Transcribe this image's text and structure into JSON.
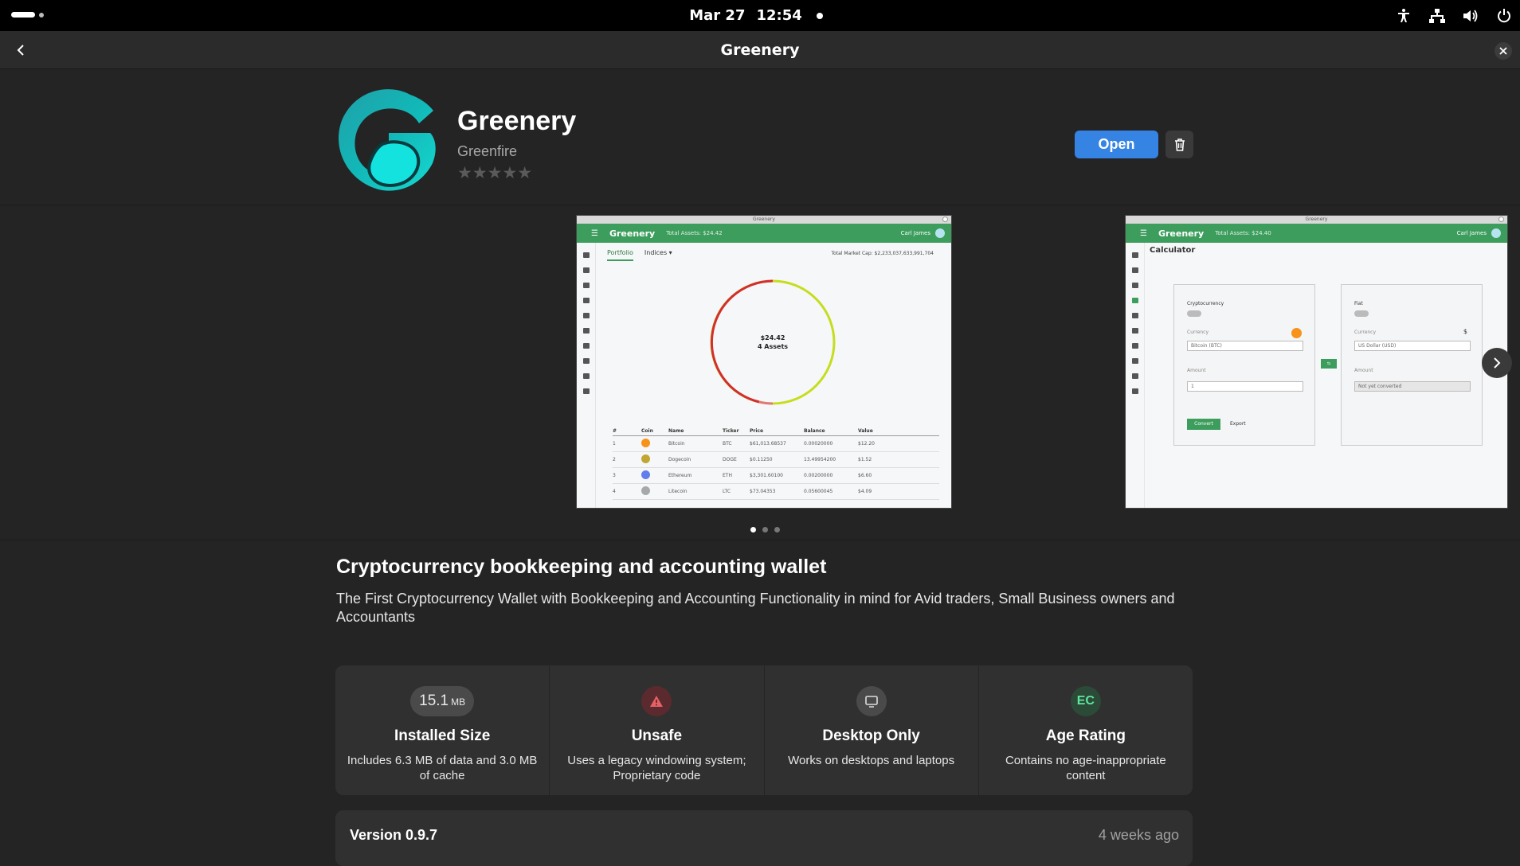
{
  "topbar": {
    "date": "Mar 27",
    "time": "12:54"
  },
  "header": {
    "title": "Greenery"
  },
  "app": {
    "name": "Greenery",
    "developer": "Greenfire",
    "stars": "★★★★★",
    "open_label": "Open",
    "accent_color": "#3584e4"
  },
  "screenshots": {
    "shot1": {
      "window_title": "Greenery",
      "app_name": "Greenery",
      "total_assets": "Total Assets: $24.42",
      "user": "Carl James",
      "tab_portfolio": "Portfolio",
      "tab_indices": "Indices ▾",
      "market_cap": "Total Market Cap: $2,233,037,633,991,704",
      "donut_value": "$24.42",
      "donut_assets": "4 Assets",
      "table": {
        "headers": [
          "#",
          "Coin",
          "Name",
          "Ticker",
          "Price",
          "Balance",
          "Value"
        ],
        "rows": [
          {
            "n": "1",
            "name": "Bitcoin",
            "ticker": "BTC",
            "price": "$61,013.68537",
            "balance": "0.00020000",
            "value": "$12.20",
            "color": "#f7931a"
          },
          {
            "n": "2",
            "name": "Dogecoin",
            "ticker": "DOGE",
            "price": "$0.11250",
            "balance": "13.49954200",
            "value": "$1.52",
            "color": "#c2a633"
          },
          {
            "n": "3",
            "name": "Ethereum",
            "ticker": "ETH",
            "price": "$3,301.60100",
            "balance": "0.00200000",
            "value": "$6.60",
            "color": "#627eea"
          },
          {
            "n": "4",
            "name": "Litecoin",
            "ticker": "LTC",
            "price": "$73.04353",
            "balance": "0.05600045",
            "value": "$4.09",
            "color": "#a6a9aa"
          }
        ]
      }
    },
    "shot2": {
      "window_title": "Greenery",
      "app_name": "Greenery",
      "total_assets": "Total Assets: $24.40",
      "user": "Carl James",
      "page_title": "Calculator",
      "left_card": {
        "title": "Cryptocurrency",
        "currency_label": "Currency",
        "currency_value": "Bitcoin (BTC)",
        "amount_label": "Amount",
        "amount_value": "1",
        "convert_label": "Convert",
        "export_label": "Export"
      },
      "right_card": {
        "title": "Fiat",
        "currency_label": "Currency",
        "currency_symbol": "$",
        "currency_value": "US Dollar (USD)",
        "amount_label": "Amount",
        "amount_value": "Not yet converted"
      }
    }
  },
  "summary": "Cryptocurrency bookkeeping and accounting wallet",
  "description": "The First Cryptocurrency Wallet with Bookkeeping and Accounting Functionality in mind for Avid traders, Small Business owners and Accountants",
  "tiles": [
    {
      "badge_value": "15.1",
      "badge_unit": "MB",
      "title": "Installed Size",
      "desc": "Includes 6.3 MB of data and 3.0 MB of cache"
    },
    {
      "icon": "warning-icon",
      "title": "Unsafe",
      "desc": "Uses a legacy windowing system; Proprietary code",
      "color": "#c01c28"
    },
    {
      "icon": "desktop-icon",
      "title": "Desktop Only",
      "desc": "Works on desktops and laptops"
    },
    {
      "badge_text": "EC",
      "title": "Age Rating",
      "desc": "Contains no age-inappropriate content",
      "color": "#2ec27e"
    }
  ],
  "version": {
    "title": "Version 0.9.7",
    "date": "4 weeks ago"
  }
}
